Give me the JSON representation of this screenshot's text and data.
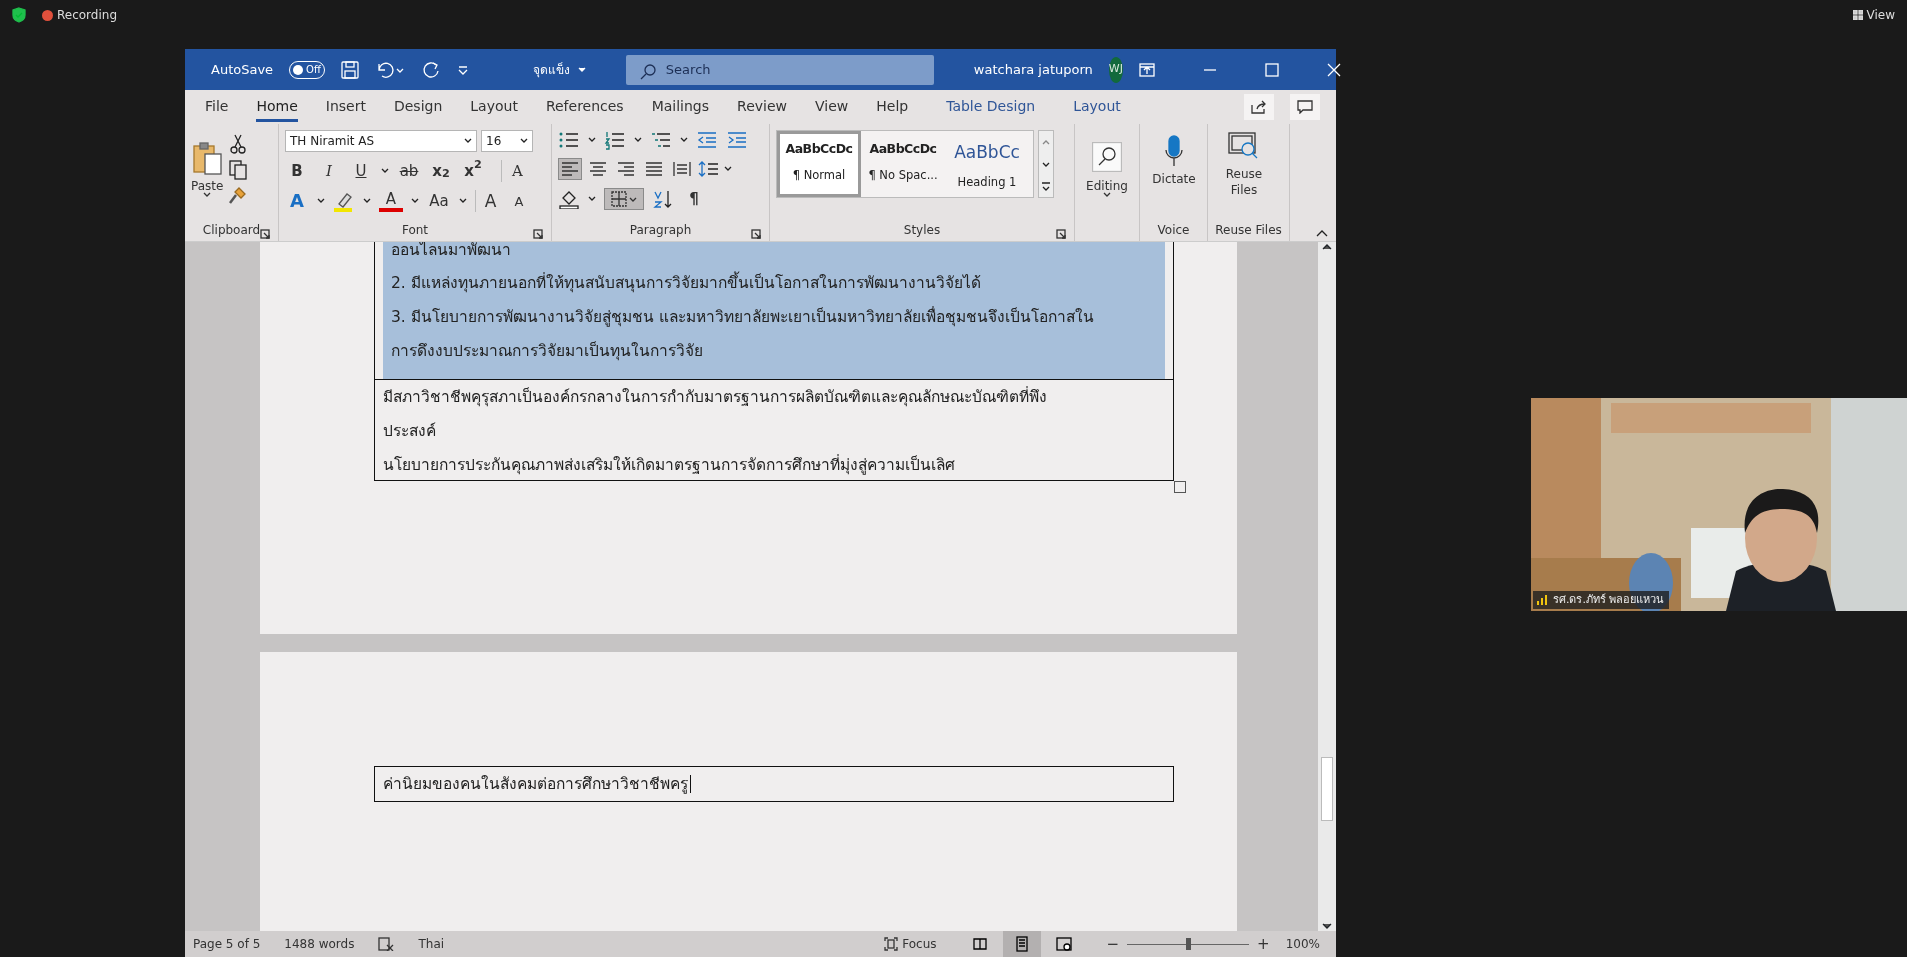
{
  "meeting": {
    "recording_label": "Recording",
    "view_label": "View"
  },
  "word": {
    "autosave": {
      "label": "AutoSave",
      "on": false,
      "state_text": "Off"
    },
    "document_title": "จุดแข็ง",
    "search": {
      "placeholder": "Search"
    },
    "user": {
      "name": "watchara jatuporn",
      "initials": "WJ"
    },
    "tabs": [
      {
        "label": "File",
        "selected": false,
        "kind": "normal"
      },
      {
        "label": "Home",
        "selected": true,
        "kind": "normal"
      },
      {
        "label": "Insert",
        "selected": false,
        "kind": "normal"
      },
      {
        "label": "Design",
        "selected": false,
        "kind": "normal"
      },
      {
        "label": "Layout",
        "selected": false,
        "kind": "normal"
      },
      {
        "label": "References",
        "selected": false,
        "kind": "normal"
      },
      {
        "label": "Mailings",
        "selected": false,
        "kind": "normal"
      },
      {
        "label": "Review",
        "selected": false,
        "kind": "normal"
      },
      {
        "label": "View",
        "selected": false,
        "kind": "normal"
      },
      {
        "label": "Help",
        "selected": false,
        "kind": "normal"
      },
      {
        "label": "Table Design",
        "selected": false,
        "kind": "contextual"
      },
      {
        "label": "Layout",
        "selected": false,
        "kind": "contextual"
      }
    ],
    "ribbon": {
      "paste_label": "Paste",
      "font_name": "TH Niramit AS",
      "font_size": "16",
      "format_buttons": [
        {
          "kind": "bold",
          "text": "B"
        },
        {
          "kind": "italic",
          "text": "I"
        },
        {
          "kind": "underline",
          "text": "U"
        },
        {
          "kind": "strike",
          "text": "ab"
        },
        {
          "kind": "subscript",
          "text": "x$_{2}$"
        },
        {
          "kind": "superscript",
          "text": "x$^{2}$"
        }
      ],
      "clear_text": "A",
      "effect_buttons": [
        {
          "kind": "effects",
          "text": "A"
        },
        {
          "kind": "highlight"
        },
        {
          "kind": "color",
          "text": "A"
        },
        {
          "kind": "case",
          "text": "Aa"
        },
        {
          "kind": "grow",
          "text": "A"
        },
        {
          "kind": "shrink",
          "text": "A"
        }
      ],
      "alignment": [
        {
          "kind": "left",
          "selected": true
        },
        {
          "kind": "center",
          "selected": false
        },
        {
          "kind": "right",
          "selected": false
        },
        {
          "kind": "justify",
          "selected": false
        },
        {
          "kind": "distributed",
          "selected": false
        }
      ],
      "borders": {
        "pressed": true
      },
      "pilcrow": "¶",
      "styles": [
        {
          "preview": "AaBbCcDc",
          "name": "¶ Normal",
          "selected": true,
          "kind": "body"
        },
        {
          "preview": "AaBbCcDc",
          "name": "¶ No Spac...",
          "selected": false,
          "kind": "body"
        },
        {
          "preview": "AaBbCc",
          "name": "Heading 1",
          "selected": false,
          "kind": "heading"
        }
      ],
      "editing_label": "Editing",
      "dictate_label": "Dictate",
      "reuse_label": "Reuse Files",
      "group_labels": [
        "Clipboard",
        "Font",
        "Paragraph",
        "Styles",
        "Voice",
        "Reuse Files"
      ]
    },
    "document": {
      "highlighted_cell": [
        "ออนไลนมาพัฒนา",
        "2. มีแหล่งทุนภายนอกที่ให้ทุนสนับสนุนการวิจัยมากขึ้นเป็นโอกาสในการพัฒนางานวิจัยได้",
        "3. มีนโยบายการพัฒนางานวิจัยสู่ชุมชน และมหาวิทยาลัยพะเยาเป็นมหาวิทยาลัยเพื่อชุมชนจึงเป็นโอกาสใน",
        "การดึงงบประมาณการวิจัยมาเป็นทุนในการวิจัย"
      ],
      "next_cell": [
        "มีสภาวิชาชีพคุรุสภาเป็นองค์กรกลางในการกำกับมาตรฐานการผลิตบัณฑิตและคุณลักษณะบัณฑิตที่พึง",
        "ประสงค์",
        "นโยบายการประกันคุณภาพส่งเสริมให้เกิดมาตรฐานการจัดการศึกษาที่มุ่งสู่ความเป็นเลิศ"
      ],
      "page_two_cell": "ค่านิยมของคนในสังคมต่อการศึกษาวิชาชีพครู"
    },
    "status_bar": {
      "page": "Page 5 of 5",
      "words": "1488 words",
      "language": "Thai",
      "focus": "Focus",
      "views": [
        {
          "kind": "read",
          "selected": false
        },
        {
          "kind": "print",
          "selected": true
        },
        {
          "kind": "web",
          "selected": false
        }
      ],
      "zoom": {
        "minus": "−",
        "plus": "+",
        "level": 0.5,
        "text": "100%"
      }
    }
  },
  "video": {
    "name": "รศ.ดร.ภัทร์ พลอยแหวน"
  }
}
